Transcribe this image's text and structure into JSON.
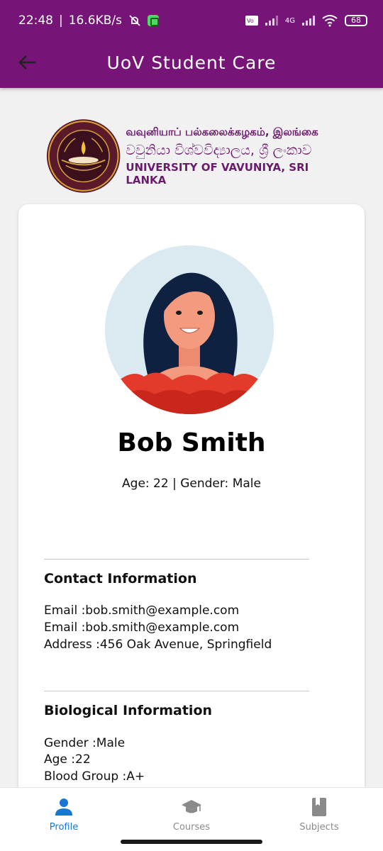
{
  "status_bar": {
    "time": "22:48",
    "net_speed": "16.6KB/s",
    "battery": "68",
    "network_type": "4G"
  },
  "app_bar": {
    "title": "UoV Student Care"
  },
  "banner": {
    "tamil": "வவுனியாப் பல்கலைக்கழகம், இலங்கை",
    "sinhala": "වවුනියා විශ්වවිද්‍යාලය, ශ්‍රී ලංකාව",
    "english": "UNIVERSITY OF VAVUNIYA, SRI LANKA"
  },
  "profile": {
    "name": "Bob Smith",
    "meta": "Age: 22 | Gender: Male"
  },
  "contact": {
    "title": "Contact Information",
    "lines": [
      "Email :bob.smith@example.com",
      "Email :bob.smith@example.com",
      "Address :456 Oak Avenue, Springfield"
    ]
  },
  "biological": {
    "title": "Biological Information",
    "lines": [
      "Gender :Male",
      "Age :22",
      "Blood Group :A+"
    ]
  },
  "bottom_nav": {
    "items": [
      {
        "label": "Profile",
        "icon": "person-icon",
        "active": true
      },
      {
        "label": "Courses",
        "icon": "graduation-cap-icon",
        "active": false
      },
      {
        "label": "Subjects",
        "icon": "book-icon",
        "active": false
      }
    ]
  },
  "colors": {
    "app_bar": "#761477",
    "banner_text": "#6b1b6c",
    "active_nav": "#1976d2",
    "inactive_nav": "#8a8a8a"
  }
}
